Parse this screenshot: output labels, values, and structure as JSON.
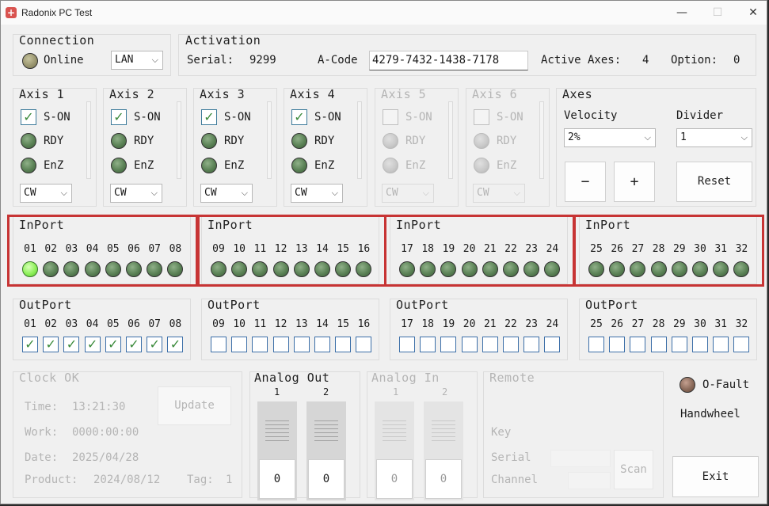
{
  "window": {
    "title": "Radonix PC Test",
    "minimize": "—",
    "maximize": "☐",
    "close": "✕"
  },
  "connection": {
    "label": "Connection",
    "status": "Online",
    "type": "LAN"
  },
  "activation": {
    "label": "Activation",
    "serial_label": "Serial:",
    "serial": "9299",
    "acode_label": "A-Code",
    "acode": "4279-7432-1438-7178",
    "active_axes_label": "Active Axes:",
    "active_axes": "4",
    "option_label": "Option:",
    "option": "0"
  },
  "axes_panels": [
    {
      "label": "Axis 1",
      "son": "S-ON",
      "rdy": "RDY",
      "enz": "EnZ",
      "dir": "CW",
      "enabled": true
    },
    {
      "label": "Axis 2",
      "son": "S-ON",
      "rdy": "RDY",
      "enz": "EnZ",
      "dir": "CW",
      "enabled": true
    },
    {
      "label": "Axis 3",
      "son": "S-ON",
      "rdy": "RDY",
      "enz": "EnZ",
      "dir": "CW",
      "enabled": true
    },
    {
      "label": "Axis 4",
      "son": "S-ON",
      "rdy": "RDY",
      "enz": "EnZ",
      "dir": "CW",
      "enabled": true
    },
    {
      "label": "Axis 5",
      "son": "S-ON",
      "rdy": "RDY",
      "enz": "EnZ",
      "dir": "CW",
      "enabled": false
    },
    {
      "label": "Axis 6",
      "son": "S-ON",
      "rdy": "RDY",
      "enz": "EnZ",
      "dir": "CW",
      "enabled": false
    }
  ],
  "axes_control": {
    "label": "Axes",
    "velocity_label": "Velocity",
    "velocity": "2%",
    "divider_label": "Divider",
    "divider": "1",
    "minus": "−",
    "plus": "+",
    "reset": "Reset"
  },
  "inport_groups": [
    {
      "label": "InPort",
      "ports": [
        "01",
        "02",
        "03",
        "04",
        "05",
        "06",
        "07",
        "08"
      ],
      "active": [
        true,
        false,
        false,
        false,
        false,
        false,
        false,
        false
      ]
    },
    {
      "label": "InPort",
      "ports": [
        "09",
        "10",
        "11",
        "12",
        "13",
        "14",
        "15",
        "16"
      ],
      "active": [
        false,
        false,
        false,
        false,
        false,
        false,
        false,
        false
      ]
    },
    {
      "label": "InPort",
      "ports": [
        "17",
        "18",
        "19",
        "20",
        "21",
        "22",
        "23",
        "24"
      ],
      "active": [
        false,
        false,
        false,
        false,
        false,
        false,
        false,
        false
      ]
    },
    {
      "label": "InPort",
      "ports": [
        "25",
        "26",
        "27",
        "28",
        "29",
        "30",
        "31",
        "32"
      ],
      "active": [
        false,
        false,
        false,
        false,
        false,
        false,
        false,
        false
      ]
    }
  ],
  "outport_groups": [
    {
      "label": "OutPort",
      "ports": [
        "01",
        "02",
        "03",
        "04",
        "05",
        "06",
        "07",
        "08"
      ],
      "checked": [
        true,
        true,
        true,
        true,
        true,
        true,
        true,
        true
      ]
    },
    {
      "label": "OutPort",
      "ports": [
        "09",
        "10",
        "11",
        "12",
        "13",
        "14",
        "15",
        "16"
      ],
      "checked": [
        false,
        false,
        false,
        false,
        false,
        false,
        false,
        false
      ]
    },
    {
      "label": "OutPort",
      "ports": [
        "17",
        "18",
        "19",
        "20",
        "21",
        "22",
        "23",
        "24"
      ],
      "checked": [
        false,
        false,
        false,
        false,
        false,
        false,
        false,
        false
      ]
    },
    {
      "label": "OutPort",
      "ports": [
        "25",
        "26",
        "27",
        "28",
        "29",
        "30",
        "31",
        "32"
      ],
      "checked": [
        false,
        false,
        false,
        false,
        false,
        false,
        false,
        false
      ]
    }
  ],
  "clock": {
    "label": "Clock OK",
    "time_label": "Time:",
    "time": "13:21:30",
    "work_label": "Work:",
    "work": "0000:00:00",
    "date_label": "Date:",
    "date": "2025/04/28",
    "product_label": "Product:",
    "product": "2024/08/12",
    "tag_label": "Tag:",
    "tag": "1",
    "update": "Update"
  },
  "analog_out": {
    "label": "Analog Out",
    "channels": [
      {
        "num": "1",
        "value": "0"
      },
      {
        "num": "2",
        "value": "0"
      }
    ]
  },
  "analog_in": {
    "label": "Analog In",
    "channels": [
      {
        "num": "1",
        "value": "0"
      },
      {
        "num": "2",
        "value": "0"
      }
    ]
  },
  "remote": {
    "label": "Remote",
    "key_label": "Key",
    "serial_label": "Serial",
    "channel_label": "Channel",
    "scan": "Scan"
  },
  "side": {
    "ofault": "O-Fault",
    "handwheel": "Handwheel",
    "exit": "Exit"
  },
  "colors": {
    "inport_frame": "#c73434",
    "led_on": "#8ef05a",
    "led_off": "#5a8155"
  }
}
